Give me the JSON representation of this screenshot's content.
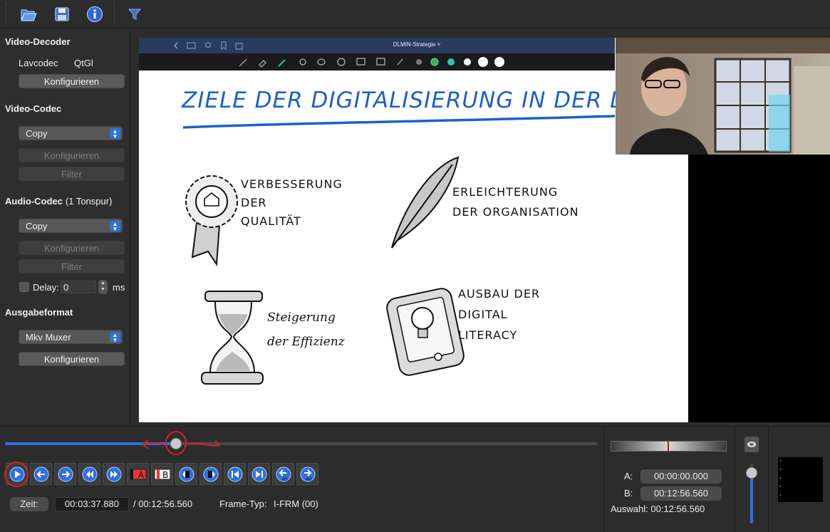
{
  "toolbar": {
    "icons": [
      "open-folder-icon",
      "save-icon",
      "info-icon",
      "filter-icon"
    ]
  },
  "sidebar": {
    "video_decoder": {
      "title": "Video-Decoder",
      "options": [
        "Lavcodec",
        "QtGl"
      ],
      "configure": "Konfigurieren"
    },
    "video_codec": {
      "title": "Video-Codec",
      "value": "Copy",
      "configure": "Konfigurieren",
      "filter": "Filter"
    },
    "audio_codec": {
      "title": "Audio-Codec",
      "subtitle": "(1 Tonspur)",
      "value": "Copy",
      "configure": "Konfigurieren",
      "filter": "Filter",
      "delay_label": "Delay:",
      "delay_value": "0",
      "delay_unit": "ms"
    },
    "output_format": {
      "title": "Ausgabeformat",
      "value": "Mkv Muxer",
      "configure": "Konfigurieren"
    }
  },
  "video": {
    "app_title": "DLMIN-Strategie ˅",
    "heading": "ZIELE DER DIGITALISIERUNG IN DER LEHRE",
    "items": [
      {
        "line1": "VERBESSERUNG",
        "line2": "DER",
        "line3": "QUALITÄT"
      },
      {
        "line1": "ERLEICHTERUNG",
        "line2": "DER ORGANISATION",
        "line3": ""
      },
      {
        "line1": "Steigerung",
        "line2": "der Effizienz",
        "line3": ""
      },
      {
        "line1": "AUSBAU DER",
        "line2": "DIGITAL",
        "line3": "LITERACY"
      }
    ],
    "colors": {
      "heading": "#1f5fc9",
      "nav_bar": "#2a3c5e"
    }
  },
  "playback": {
    "progress": 0.2885,
    "time_label": "Zeit:",
    "current_time": "00:03:37.880",
    "total_time": "/ 00:12:56.560",
    "frame_type_label": "Frame-Typ:",
    "frame_type": "I-FRM (00)",
    "controls": [
      "play-icon",
      "prev-frame-icon",
      "next-frame-icon",
      "rewind-icon",
      "fast-forward-icon",
      "set-marker-a-icon",
      "set-marker-b-icon",
      "prev-black-frame-icon",
      "next-black-frame-icon",
      "go-start-icon",
      "go-end-icon",
      "back-60s-icon",
      "forward-60s-icon"
    ]
  },
  "selection": {
    "a_label": "A:",
    "a_value": "00:00:00.000",
    "b_label": "B:",
    "b_value": "00:12:56.560",
    "selection_label": "Auswahl:",
    "selection_value": "00:12:56.560"
  },
  "volume": {
    "level": 0.85
  }
}
